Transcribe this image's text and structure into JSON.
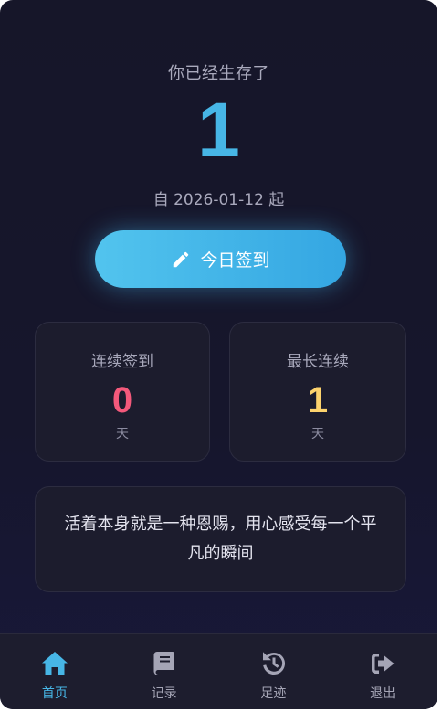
{
  "hero": {
    "survived_label": "你已经生存了",
    "day_count": "1",
    "since_text": "自 2026-01-12 起"
  },
  "checkin": {
    "label": "今日签到",
    "icon": "pencil-icon"
  },
  "stats": {
    "streak": {
      "title": "连续签到",
      "value": "0",
      "unit": "天",
      "color": "#f4597b"
    },
    "longest": {
      "title": "最长连续",
      "value": "1",
      "unit": "天",
      "color": "#fdd36d"
    }
  },
  "quote": {
    "text": "活着本身就是一种恩赐，用心感受每一个平凡的瞬间"
  },
  "nav": {
    "home": {
      "label": "首页",
      "icon": "home-icon",
      "active": true
    },
    "records": {
      "label": "记录",
      "icon": "book-icon",
      "active": false
    },
    "footprints": {
      "label": "足迹",
      "icon": "history-icon",
      "active": false
    },
    "logout": {
      "label": "退出",
      "icon": "logout-icon",
      "active": false
    }
  },
  "colors": {
    "accent": "#47b6e6",
    "background": "#161629",
    "card": "#1c1c2d"
  }
}
